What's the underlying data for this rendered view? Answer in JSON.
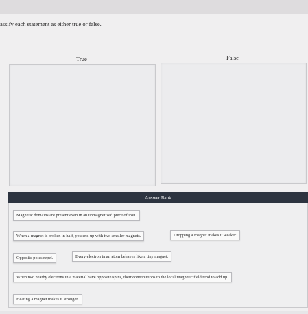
{
  "prompt": "assify each statement as either true or false.",
  "columns": {
    "true_label": "True",
    "false_label": "False"
  },
  "answer_bank": {
    "title": "Answer Bank",
    "items": [
      "Magnetic domains are present even in an unmagnetized piece of iron.",
      "When a magnet is broken in half, you end up with two smaller magnets.",
      "Dropping a magnet makes it weaker.",
      "Opposite poles repel.",
      "Every electron in an atom behaves like a tiny magnet.",
      "When two nearby electrons in a material have opposite spins, their contributions to the local magnetic field tend to add up.",
      "Heating a magnet makes it stronger."
    ]
  }
}
